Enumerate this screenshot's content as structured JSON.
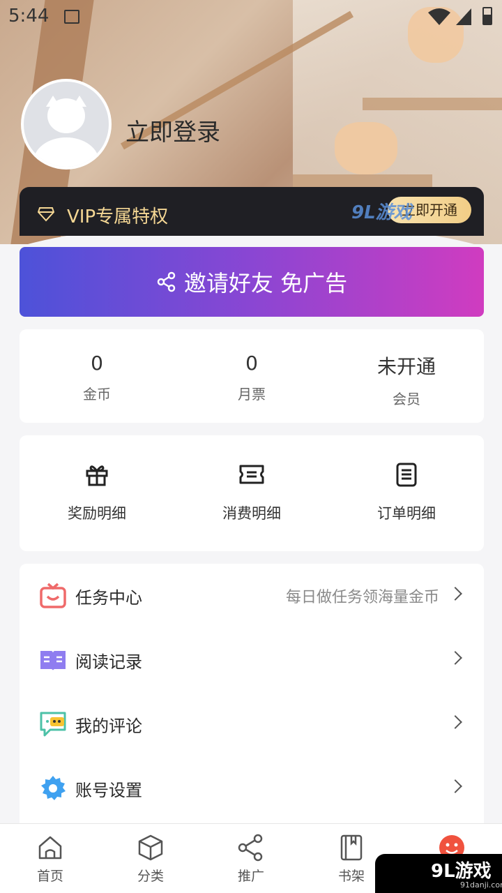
{
  "status_bar": {
    "time": "5:44"
  },
  "profile": {
    "login_text": "立即登录"
  },
  "vip": {
    "label": "VIP专属特权",
    "open_button": "立即开通",
    "watermark": "9L游戏"
  },
  "invite": {
    "label": "邀请好友 免广告"
  },
  "stats": [
    {
      "value": "0",
      "label": "金币"
    },
    {
      "value": "0",
      "label": "月票"
    },
    {
      "value": "未开通",
      "label": "会员"
    }
  ],
  "quick_actions": [
    {
      "label": "奖励明细",
      "icon": "gift-icon"
    },
    {
      "label": "消费明细",
      "icon": "ticket-icon"
    },
    {
      "label": "订单明细",
      "icon": "list-icon"
    }
  ],
  "menu": [
    {
      "title": "任务中心",
      "hint": "每日做任务领海量金币",
      "icon": "tv-icon",
      "color": "#ef6a6a"
    },
    {
      "title": "阅读记录",
      "hint": "",
      "icon": "book-open-icon",
      "color": "#8f7df0"
    },
    {
      "title": "我的评论",
      "hint": "",
      "icon": "comment-icon",
      "color": "#4cc1a7"
    },
    {
      "title": "账号设置",
      "hint": "",
      "icon": "gear-icon",
      "color": "#3fa1f0"
    }
  ],
  "tabs": [
    {
      "label": "首页",
      "icon": "home-icon"
    },
    {
      "label": "分类",
      "icon": "cube-icon"
    },
    {
      "label": "推广",
      "icon": "share-icon"
    },
    {
      "label": "书架",
      "icon": "bookshelf-icon"
    },
    {
      "label": "",
      "icon": "smile-icon"
    }
  ],
  "bottom_watermark": {
    "main": "9L游戏",
    "sub": "91danji.com"
  },
  "colors": {
    "accent": "#f0523e",
    "vip_gold": "#f5d794",
    "banner_start": "#4d52d9",
    "banner_end": "#d03cc0"
  }
}
